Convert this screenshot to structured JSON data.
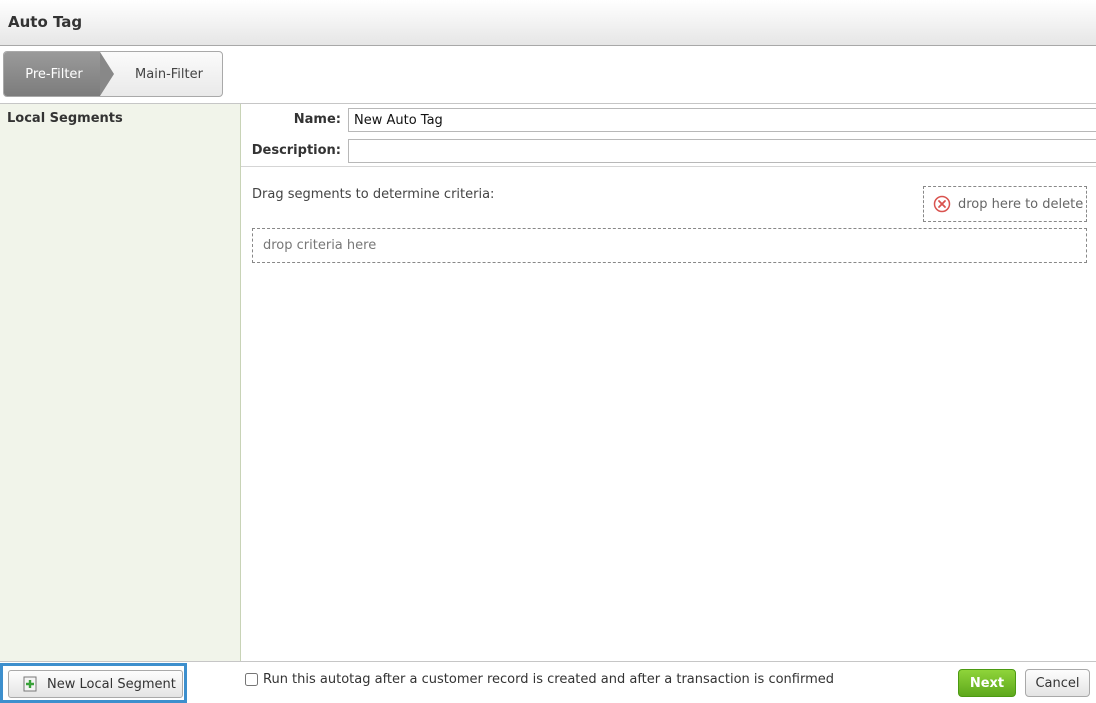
{
  "window": {
    "title": "Auto Tag"
  },
  "steps": [
    {
      "label": "Pre-Filter",
      "active": true
    },
    {
      "label": "Main-Filter",
      "active": false
    }
  ],
  "sidebar": {
    "heading": "Local Segments"
  },
  "form": {
    "name_label": "Name:",
    "name_value": "New Auto Tag",
    "description_label": "Description:",
    "description_value": ""
  },
  "criteria": {
    "hint": "Drag segments to determine criteria:",
    "delete_zone": "drop here to delete",
    "drop_zone": "drop criteria here"
  },
  "footer": {
    "new_segment_button": "New Local Segment",
    "run_checkbox_label": "Run this autotag after a customer record is created and after a transaction is confirmed",
    "run_checked": false,
    "next_button": "Next",
    "cancel_button": "Cancel"
  },
  "colors": {
    "accent_green": "#5ea81c",
    "sidebar_bg": "#f1f4ea",
    "highlight_blue": "#3d8fcd",
    "delete_red": "#d9534f"
  },
  "icons": {
    "delete": "x-circle-icon",
    "new_segment": "plus-box-icon"
  }
}
